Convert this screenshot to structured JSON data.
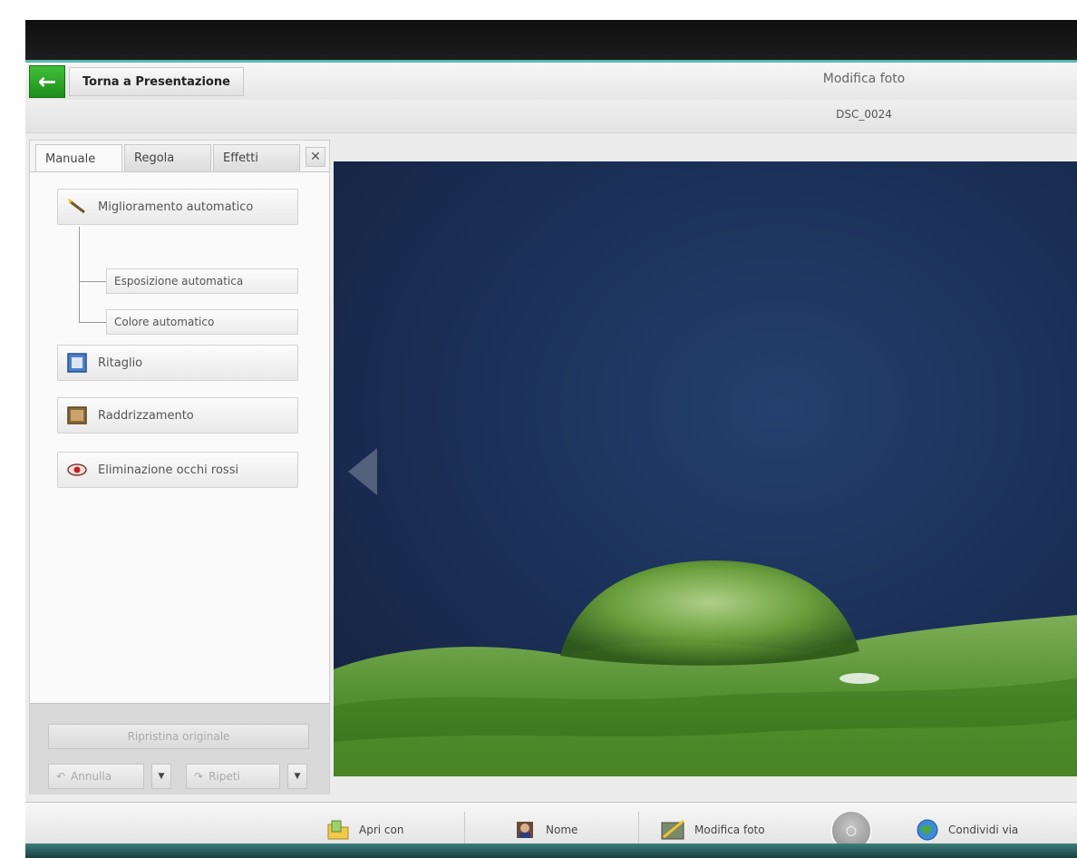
{
  "header": {
    "back_label": "Torna a Presentazione",
    "title": "Modifica foto",
    "file_name": "DSC_0024"
  },
  "tabs": [
    {
      "label": "Manuale"
    },
    {
      "label": "Regola"
    },
    {
      "label": "Effetti"
    }
  ],
  "tools": {
    "auto_enhance": "Miglioramento automatico",
    "auto_exposure": "Esposizione automatica",
    "auto_color": "Colore automatico",
    "crop": "Ritaglio",
    "straighten": "Raddrizzamento",
    "red_eye": "Eliminazione occhi rossi"
  },
  "panel_bottom": {
    "restore": "Ripristina originale",
    "undo": "Annulla",
    "redo": "Ripeti"
  },
  "bottom_bar": {
    "open": "Apri con",
    "name": "Nome",
    "edit": "Modifica foto",
    "share": "Condividi via"
  },
  "icons": {
    "back": "arrow-left-icon",
    "close": "close-icon",
    "prev": "triangle-left-icon"
  }
}
